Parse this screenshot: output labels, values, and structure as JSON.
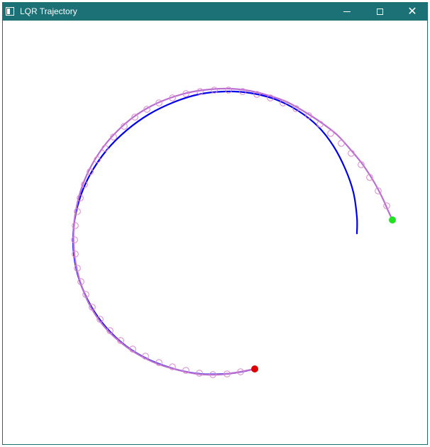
{
  "window": {
    "title": "LQR Trajectory",
    "controls": [
      "minimize",
      "maximize",
      "close"
    ],
    "close_glyph": "✕"
  },
  "plot": {
    "reference_color": "#0000ee",
    "trajectory_color": "#b96fd2",
    "marker_color": "#d987cb",
    "start_color": "#22e022",
    "end_color": "#e00000"
  }
}
